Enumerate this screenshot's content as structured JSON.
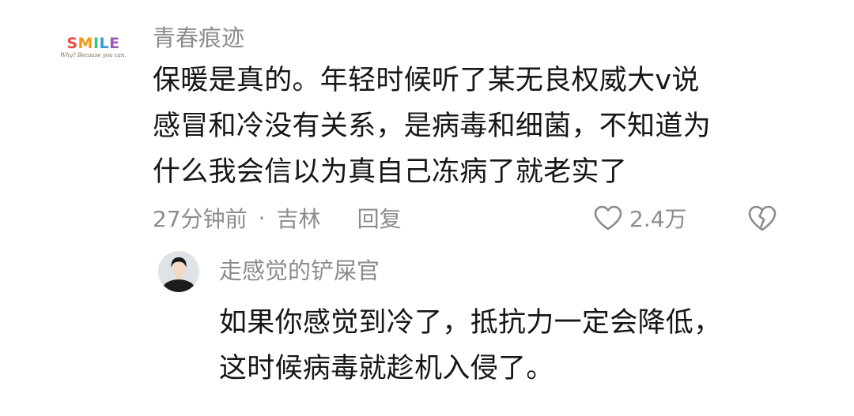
{
  "comment": {
    "avatar_logo": {
      "letters": [
        "S",
        "M",
        "I",
        "L",
        "E"
      ],
      "letter_colors": [
        "#e94b3c",
        "#f39c12",
        "#2ecc71",
        "#3498db",
        "#9b59b6"
      ],
      "tagline": "Why? Because you can."
    },
    "username": "青春痕迹",
    "text_lines": [
      "保暖是真的。年轻时候听了某无良权威大v说",
      "感冒和冷没有关系，是病毒和细菌，不知道为",
      "什么我会信以为真自己冻病了就老实了"
    ],
    "time": "27分钟前",
    "separator": "·",
    "location": "吉林",
    "reply_label": "回复",
    "like_count": "2.4万",
    "like_icon": "heart-outline-icon",
    "dislike_icon": "broken-heart-icon"
  },
  "reply": {
    "username": "走感觉的铲屎官",
    "text_lines": [
      "如果你感觉到冷了，抵抗力一定会降低，",
      "这时候病毒就趁机入侵了。"
    ]
  },
  "colors": {
    "text_primary": "#161616",
    "text_secondary": "#8c8c8c",
    "background": "#ffffff"
  }
}
